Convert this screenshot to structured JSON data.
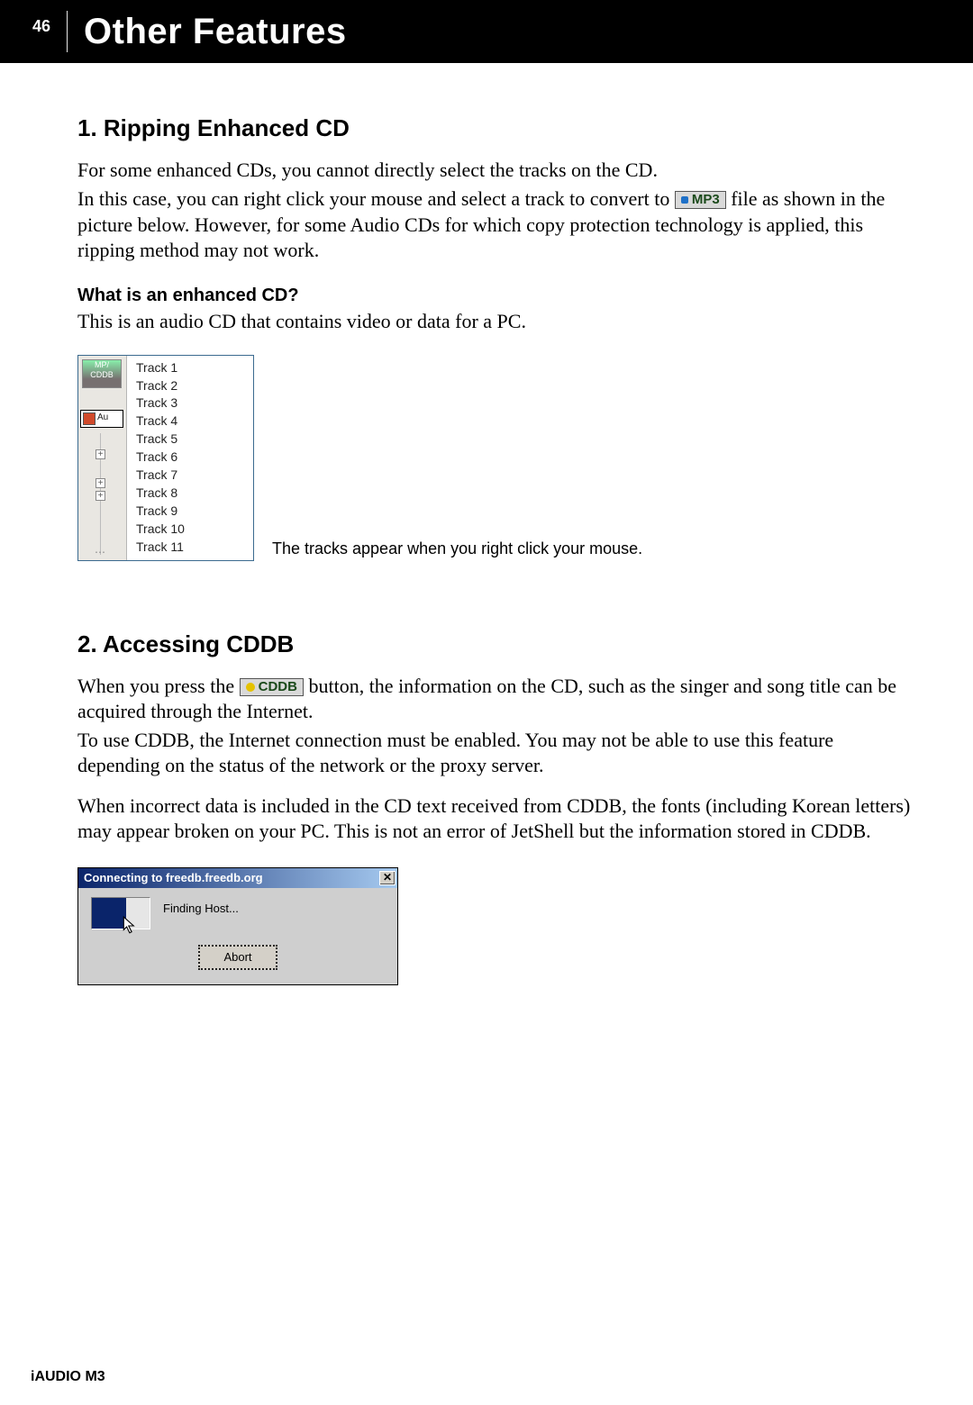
{
  "header": {
    "page_number": "46",
    "title": "Other Features"
  },
  "section1": {
    "heading": "1. Ripping Enhanced CD",
    "p1": "For some enhanced CDs, you cannot directly select the tracks on the CD.",
    "p2a": "In this case, you can right click your mouse and select a track to convert to ",
    "p2_chip": "MP3",
    "p2b": " file as shown in the picture below. However, for some Audio CDs for which copy protection technology is applied, this ripping method may not work.",
    "q": "What is an enhanced CD?",
    "a": "This is an audio CD that contains video or data for a PC.",
    "fig_left_logo_label": "CDDB",
    "fig_left_aud_label": "Au",
    "tracks": [
      "Track 1",
      "Track 2",
      "Track 3",
      "Track 4",
      "Track 5",
      "Track 6",
      "Track 7",
      "Track 8",
      "Track 9",
      "Track 10",
      "Track 11"
    ],
    "caption": "The tracks appear when you right click your mouse."
  },
  "section2": {
    "heading": "2. Accessing CDDB",
    "p1a": "When you press the ",
    "chip": "CDDB",
    "p1b": " button, the information on the CD, such as the singer and song title can be acquired through the Internet.",
    "p2": "To use CDDB, the Internet connection must be enabled. You may not be able to use this feature depending on the status of the network or the proxy server.",
    "p3": "When incorrect data is included in the CD text received from CDDB, the fonts (including Korean letters) may appear broken on your PC. This is not an error of JetShell but the information stored in CDDB.",
    "dialog": {
      "title": "Connecting to freedb.freedb.org",
      "status": "Finding Host...",
      "button": "Abort"
    }
  },
  "footer": "iAUDIO M3"
}
